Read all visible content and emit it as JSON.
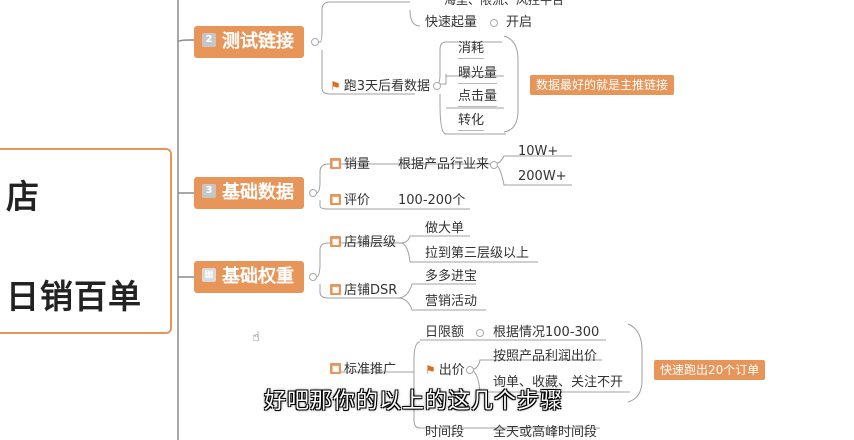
{
  "root": {
    "line1": "店",
    "line2": "日销百单"
  },
  "branches": {
    "test_link": {
      "num": "2",
      "label": "测试链接",
      "top_partial": "海里、限流、风控平台",
      "quick_rank": {
        "label": "快速起量",
        "value": "开启"
      },
      "three_day": {
        "label": "跑3天后看数据",
        "items": [
          "消耗",
          "曝光量",
          "点击量",
          "转化"
        ]
      },
      "note": "数据最好的就是主推链接"
    },
    "basic_data": {
      "num": "3",
      "label": "基础数据",
      "sales": {
        "label": "销量",
        "basis": "根据产品行业来",
        "values": [
          "10W+",
          "200W+"
        ]
      },
      "review": {
        "label": "评价",
        "value": "100-200个"
      }
    },
    "basic_weight": {
      "label": "基础权重",
      "shop_level": {
        "label": "店铺层级",
        "items": [
          "做大单",
          "拉到第三层级以上"
        ]
      },
      "shop_dsr": {
        "label": "店铺DSR",
        "items": [
          "多多进宝",
          "营销活动"
        ]
      }
    },
    "promo": {
      "label": "标准推广",
      "daily_limit": {
        "label": "日限额",
        "value": "根据情况100-300"
      },
      "bid": {
        "label": "出价",
        "items": [
          "按照产品利润出价",
          "询单、收藏、关注不开"
        ]
      },
      "time_slot": {
        "label": "时间段",
        "value": "全天或高峰时间段"
      },
      "note": "快速跑出20个订单"
    }
  },
  "caption": "好吧那你的以上的这几个步骤",
  "colors": {
    "accent": "#e8955a",
    "line": "#999999"
  }
}
